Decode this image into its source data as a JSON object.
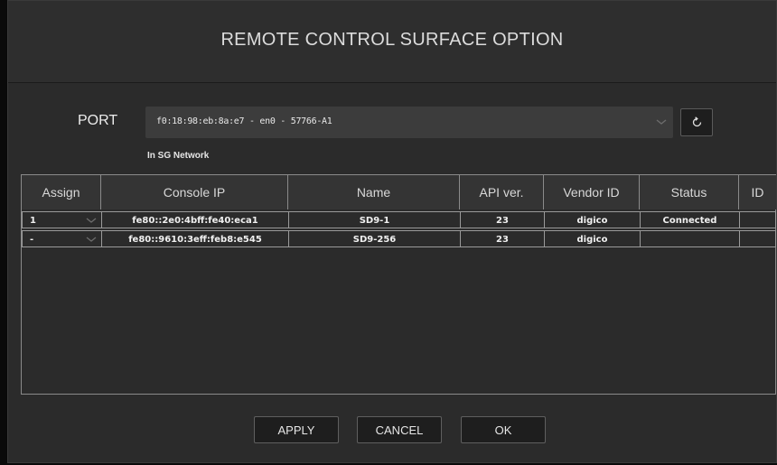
{
  "dialog": {
    "title": "REMOTE CONTROL SURFACE OPTION"
  },
  "port": {
    "label": "PORT",
    "selected_value": "f0:18:98:eb:8a:e7 - en0 - 57766-A1",
    "network_status": "In SG Network",
    "refresh_icon": "refresh-icon",
    "chevron_icon": "chevron-down-icon"
  },
  "table": {
    "headers": {
      "assign": "Assign",
      "console_ip": "Console IP",
      "name": "Name",
      "api_ver": "API ver.",
      "vendor_id": "Vendor ID",
      "status": "Status",
      "id": "ID"
    },
    "rows": [
      {
        "assign": "1",
        "console_ip": "fe80::2e0:4bff:fe40:eca1",
        "name": "SD9-1",
        "api_ver": "23",
        "vendor_id": "digico",
        "status": "Connected",
        "id": ""
      },
      {
        "assign": "-",
        "console_ip": "fe80::9610:3eff:feb8:e545",
        "name": "SD9-256",
        "api_ver": "23",
        "vendor_id": "digico",
        "status": "",
        "id": ""
      }
    ]
  },
  "buttons": {
    "apply": "APPLY",
    "cancel": "CANCEL",
    "ok": "OK"
  },
  "colors": {
    "background": "#2b2b2b",
    "table_border": "#9a9a9a",
    "text": "#e6e6e6"
  }
}
